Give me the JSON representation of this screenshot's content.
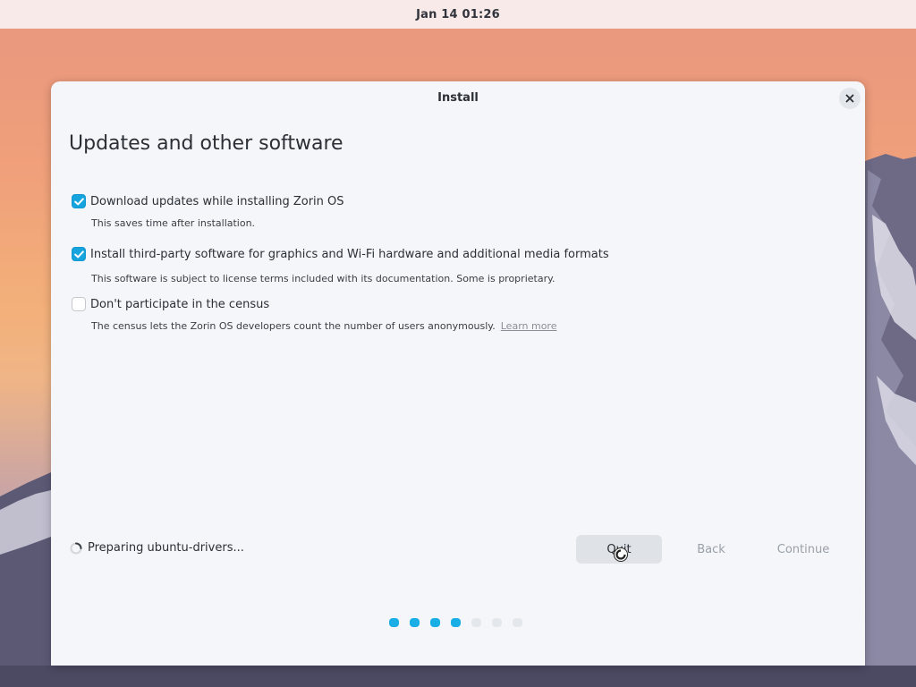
{
  "topbar": {
    "clock": "Jan 14  01:26"
  },
  "window": {
    "title": "Install"
  },
  "page": {
    "heading": "Updates and other software"
  },
  "options": [
    {
      "label": "Download updates while installing Zorin OS",
      "description": "This saves time after installation.",
      "checked": true
    },
    {
      "label": "Install third-party software for graphics and Wi-Fi hardware and additional media formats",
      "description": "This software is subject to license terms included with its documentation. Some is proprietary.",
      "checked": true
    },
    {
      "label": "Don't participate in the census",
      "description": "The census lets the Zorin OS developers count the number of users anonymously.",
      "link": "Learn more",
      "checked": false
    }
  ],
  "status": {
    "text": "Preparing ubuntu-drivers..."
  },
  "buttons": {
    "quit": "Quit",
    "back": "Back",
    "continue": "Continue"
  },
  "progress": {
    "total_steps": 7,
    "completed_steps": 4
  },
  "colors": {
    "accent": "#16a4de",
    "topbar": "#f8eae8",
    "window_bg": "#f4f6f9"
  },
  "icons": {
    "close": "close-icon",
    "check": "check-icon",
    "spinner": "spinner-icon",
    "cursor": "busy-cursor-icon"
  }
}
